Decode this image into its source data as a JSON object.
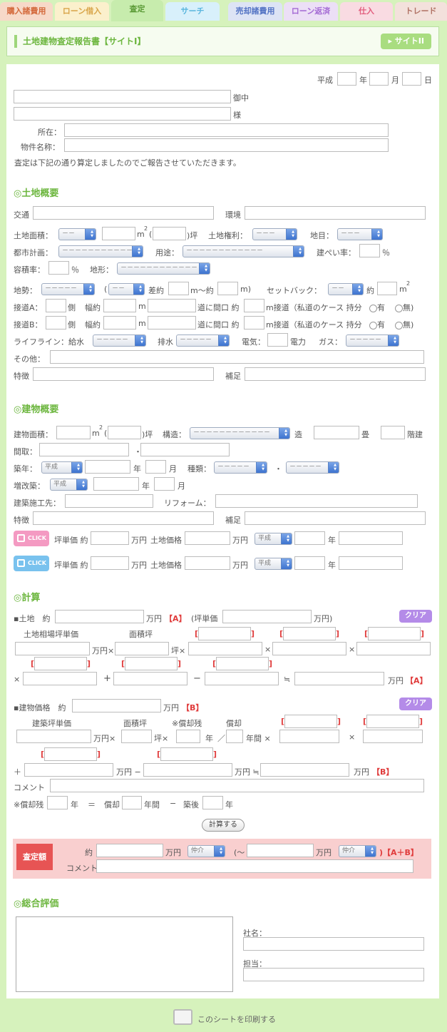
{
  "tabs": [
    "購入諸費用",
    "ローン借入",
    "査定",
    "サーチ",
    "売却諸費用",
    "ローン返済",
    "仕入",
    "トレード"
  ],
  "header": {
    "title": "土地建物査定報告書【サイトI】",
    "button": "▸ サイトII"
  },
  "date": {
    "era": "平成",
    "year": "年",
    "month": "月",
    "day": "日"
  },
  "addr": {
    "onchu": "御中",
    "sama": "様",
    "location": "所在：",
    "property": "物件名称：",
    "notice": "査定は下記の通り算定しましたのでご報告させていただきます。"
  },
  "land": {
    "heading": "◎土地概要",
    "kotsu": "交通",
    "kankyo": "環境",
    "area": "土地面積：",
    "m2": "m",
    "sup2": "2",
    "tsubo": "(",
    "tsubo2": ")坪",
    "kenri": "土地権利：",
    "chimoku": "地目：",
    "toshi": "都市計画：",
    "yoto": "用途：",
    "kenpei": "建ぺい率：",
    "pct": "％",
    "yoseki": "容積率：",
    "keijo": "地形：",
    "chisei": "地勢：",
    "sagaku": "差約",
    "m_yaku": "m～約",
    "m_paren": "m)",
    "paren": "(",
    "setback": "セットバック：",
    "yaku": "約",
    "setsudoA": "接道A：",
    "setsudoB": "接道B：",
    "gawa": "側",
    "haba": "幅約",
    "m": "m",
    "maguchi": "道に間口 約",
    "setsudo": "m接道（私道のケース 持分",
    "ari": "有",
    "nashi": "無)",
    "lifeline": "ライフライン：給水",
    "haisui": "排水",
    "denki": "電気：",
    "denryoku": "電力",
    "gas": "ガス：",
    "other": "その他：",
    "tokucho": "特徴",
    "hosoku": "補足"
  },
  "building": {
    "heading": "◎建物概要",
    "area": "建物面積：",
    "m2": "m",
    "sup2": "2",
    "tsubo": "(",
    "tsubo2": ")坪",
    "kozo": "構造：",
    "zo": "造",
    "jo": "畳",
    "kaidate": "階建",
    "madori": "間取：",
    "dot": "・",
    "chikunen": "築年：",
    "era": "平成",
    "nen": "年",
    "tsuki": "月",
    "shurui": "種類：",
    "zokaichiku": "増改築：",
    "sekosaki": "建築施工先：",
    "reform": "リフォーム：",
    "tokucho": "特徴",
    "hosoku": "補足",
    "click": "CLICK",
    "tanka": "坪単価 約",
    "manen": "万円",
    "tochikakaku": "土地価格",
    "nen2": "年"
  },
  "calc": {
    "heading": "◎計算",
    "land": "▪土地　約",
    "manen": "万円",
    "a": "【A】",
    "tankaParen": "(坪単価",
    "manenParen": "万円)",
    "clear": "クリア",
    "soba": "土地相場坪単価",
    "menseki": "面積坪",
    "manenx": "万円×",
    "tsubox": "坪×",
    "x": "×",
    "plus": "+",
    "minus": "−",
    "approx": "≒",
    "bldg": "▪建物価格　約",
    "b": "【B】",
    "kenchiku": "建築坪単価",
    "menseki2": "面積坪",
    "zanon": "※償却残",
    "shokyaku": "償却",
    "nen": "年",
    "slash": "／",
    "nenkan": "年間 ×",
    "x2": "×",
    "plus2": "＋",
    "manenminus": "万円 −",
    "manenapprox": "万円 ≒",
    "comment": "コメント",
    "zanon2": "※償却残",
    "nen3": "年",
    "eq": "＝",
    "shokyaku2": "償却",
    "nenkan2": "年間",
    "minus2": "−",
    "chikugo": "築後",
    "nen4": "年",
    "calc_button": "計算する"
  },
  "result": {
    "badge": "査定額",
    "yaku": "約",
    "manen": "万円",
    "chukai": "仲介",
    "tilde": "(～",
    "ab": ")【A＋B】",
    "comment": "コメント"
  },
  "overall": {
    "heading": "◎総合評価",
    "company": "社名：",
    "tanto": "担当："
  },
  "print": "このシートを印刷する",
  "dashes": "－－－－－－－－－－－－",
  "dash2": "－－",
  "dash3": "－－－",
  "dash5": "－－－－－"
}
